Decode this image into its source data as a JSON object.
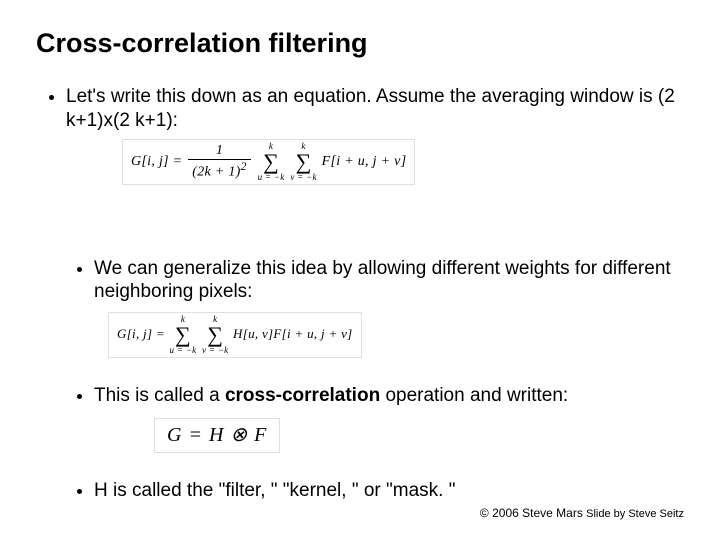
{
  "title": "Cross-correlation filtering",
  "bullet1": "Let's write this down as an equation.  Assume the averaging window is (2 k+1)x(2 k+1):",
  "bullet2": "We can generalize this idea by allowing different weights for different neighboring pixels:",
  "bullet3_pre": "This is called a ",
  "bullet3_bold": "cross-correlation",
  "bullet3_post": " operation and written:",
  "bullet4": "H is called the \"filter, \"  \"kernel, \"  or \"mask. \"",
  "eq1": {
    "lhs": "G[i, j] =",
    "frac_num": "1",
    "frac_den": "(2k + 1)",
    "frac_exp": "2",
    "sum1_up": "k",
    "sum1_lo": "u = −k",
    "sum2_up": "k",
    "sum2_lo": "v = −k",
    "rhs": "F[i + u, j + v]"
  },
  "eq2": {
    "lhs": "G[i, j] =",
    "sum1_up": "k",
    "sum1_lo": "u = −k",
    "sum2_up": "k",
    "sum2_lo": "v = −k",
    "rhs": "H[u, v]F[i + u, j + v]"
  },
  "eq3": "G = H ⊗ F",
  "footer_left": "© 2006 Steve Mars",
  "footer_right": "Slide by Steve Seitz"
}
